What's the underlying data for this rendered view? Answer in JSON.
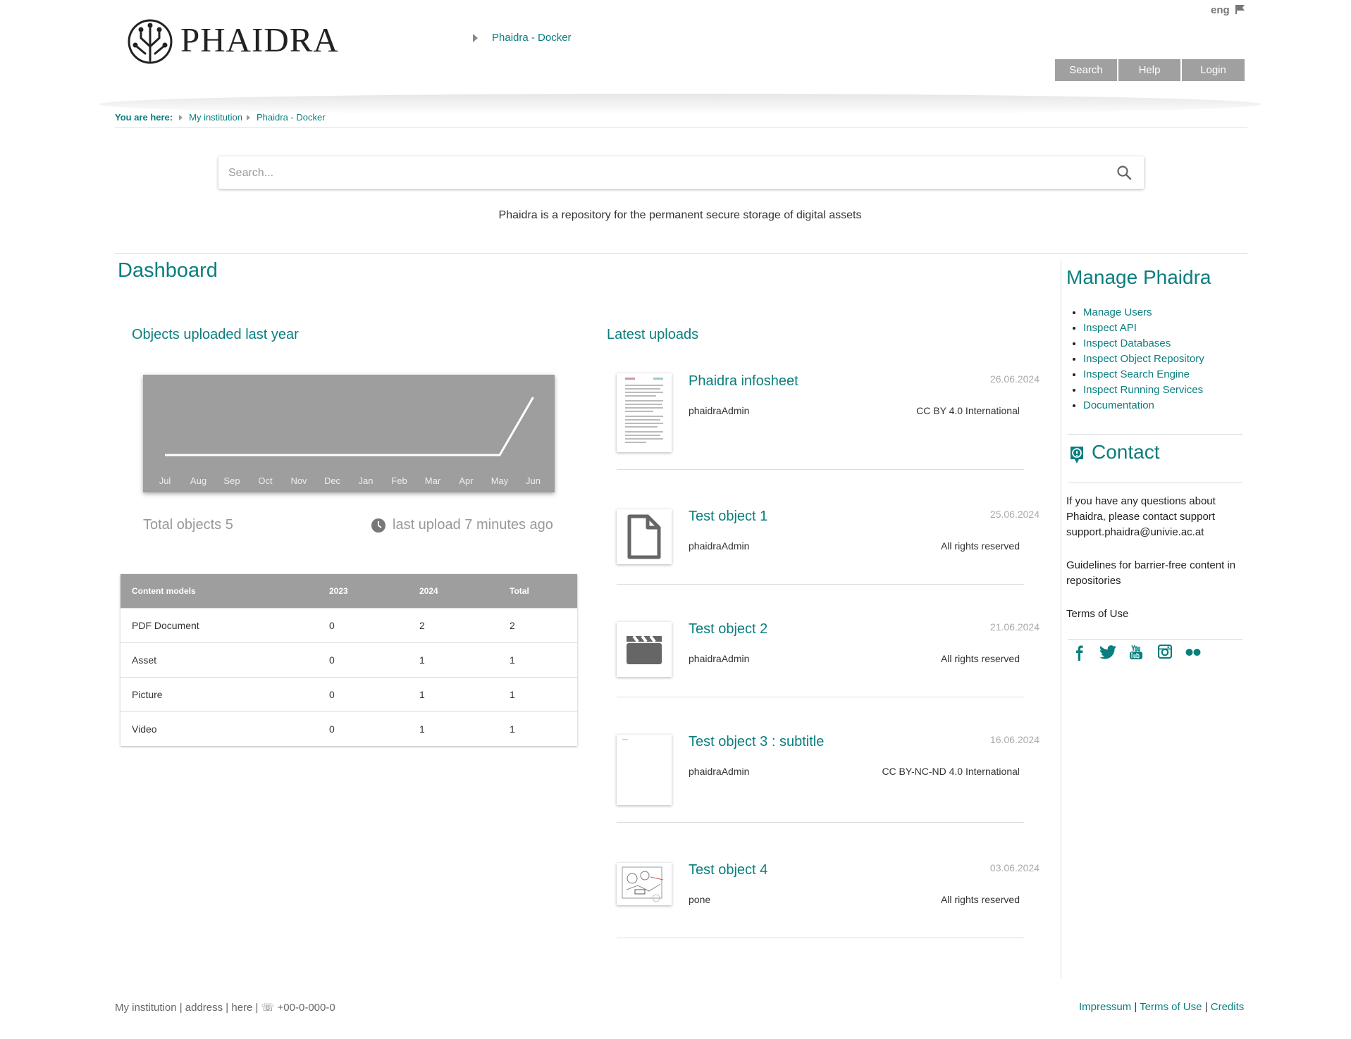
{
  "header": {
    "logo_text": "PHAIDRA",
    "instance_link": "Phaidra - Docker",
    "language": "eng",
    "nav": [
      {
        "label": "Search"
      },
      {
        "label": "Help"
      },
      {
        "label": "Login"
      }
    ]
  },
  "breadcrumb": {
    "prefix": "You are here:",
    "items": [
      "My institution",
      "Phaidra - Docker"
    ]
  },
  "search": {
    "placeholder": "Search...",
    "value": ""
  },
  "tagline": "Phaidra is a repository for the permanent secure storage of digital assets",
  "dashboard": {
    "title": "Dashboard",
    "chart_section_title": "Objects uploaded last year",
    "total_objects": "Total objects 5",
    "last_upload": "last upload 7 minutes ago",
    "latest_title": "Latest uploads"
  },
  "chart_data": {
    "type": "line",
    "categories": [
      "Jul",
      "Aug",
      "Sep",
      "Oct",
      "Nov",
      "Dec",
      "Jan",
      "Feb",
      "Mar",
      "Apr",
      "May",
      "Jun"
    ],
    "values": [
      0,
      0,
      0,
      0,
      0,
      0,
      0,
      0,
      0,
      0,
      0,
      5
    ],
    "title": "",
    "xlabel": "",
    "ylabel": "",
    "grid": false,
    "line_color": "#ffffff",
    "background": "#9e9e9e"
  },
  "content_table": {
    "headers": [
      "Content models",
      "2023",
      "2024",
      "Total"
    ],
    "rows": [
      [
        "PDF Document",
        "0",
        "2",
        "2"
      ],
      [
        "Asset",
        "0",
        "1",
        "1"
      ],
      [
        "Picture",
        "0",
        "1",
        "1"
      ],
      [
        "Video",
        "0",
        "1",
        "1"
      ]
    ]
  },
  "uploads": [
    {
      "title": "Phaidra infosheet",
      "date": "26.06.2024",
      "owner": "phaidraAdmin",
      "license": "CC BY 4.0 International",
      "thumb": "document-preview"
    },
    {
      "title": "Test object 1",
      "date": "25.06.2024",
      "owner": "phaidraAdmin",
      "license": "All rights reserved",
      "thumb": "file-icon"
    },
    {
      "title": "Test object 2",
      "date": "21.06.2024",
      "owner": "phaidraAdmin",
      "license": "All rights reserved",
      "thumb": "video-clapper-icon"
    },
    {
      "title": "Test object 3 : subtitle",
      "date": "16.06.2024",
      "owner": "phaidraAdmin",
      "license": "CC BY-NC-ND 4.0 International",
      "thumb": "blank-page-preview"
    },
    {
      "title": "Test object 4",
      "date": "03.06.2024",
      "owner": "pone",
      "license": "All rights reserved",
      "thumb": "sketch-preview"
    }
  ],
  "sidebar": {
    "manage_title": "Manage Phaidra",
    "manage_links": [
      "Manage Users",
      "Inspect API",
      "Inspect Databases",
      "Inspect Object Repository",
      "Inspect Search Engine",
      "Inspect Running Services",
      "Documentation"
    ],
    "contact_title": "Contact",
    "contact_text": "If you have any questions about Phaidra, please contact support",
    "contact_email": "support.phaidra@univie.ac.at",
    "guidelines_link": "Guidelines for barrier-free content in repositories",
    "terms_link": "Terms of Use",
    "social_icons": [
      "facebook-icon",
      "twitter-icon",
      "youtube-icon",
      "instagram-icon",
      "flickr-icon"
    ]
  },
  "footer": {
    "left": "My institution | address | here | ☏ +00-0-000-0",
    "links": [
      "Impressum",
      "Terms of Use",
      "Credits"
    ]
  },
  "colors": {
    "accent": "#0a7e7e",
    "nav_button": "#a0a0a0",
    "table_header": "#9e9e9e"
  }
}
